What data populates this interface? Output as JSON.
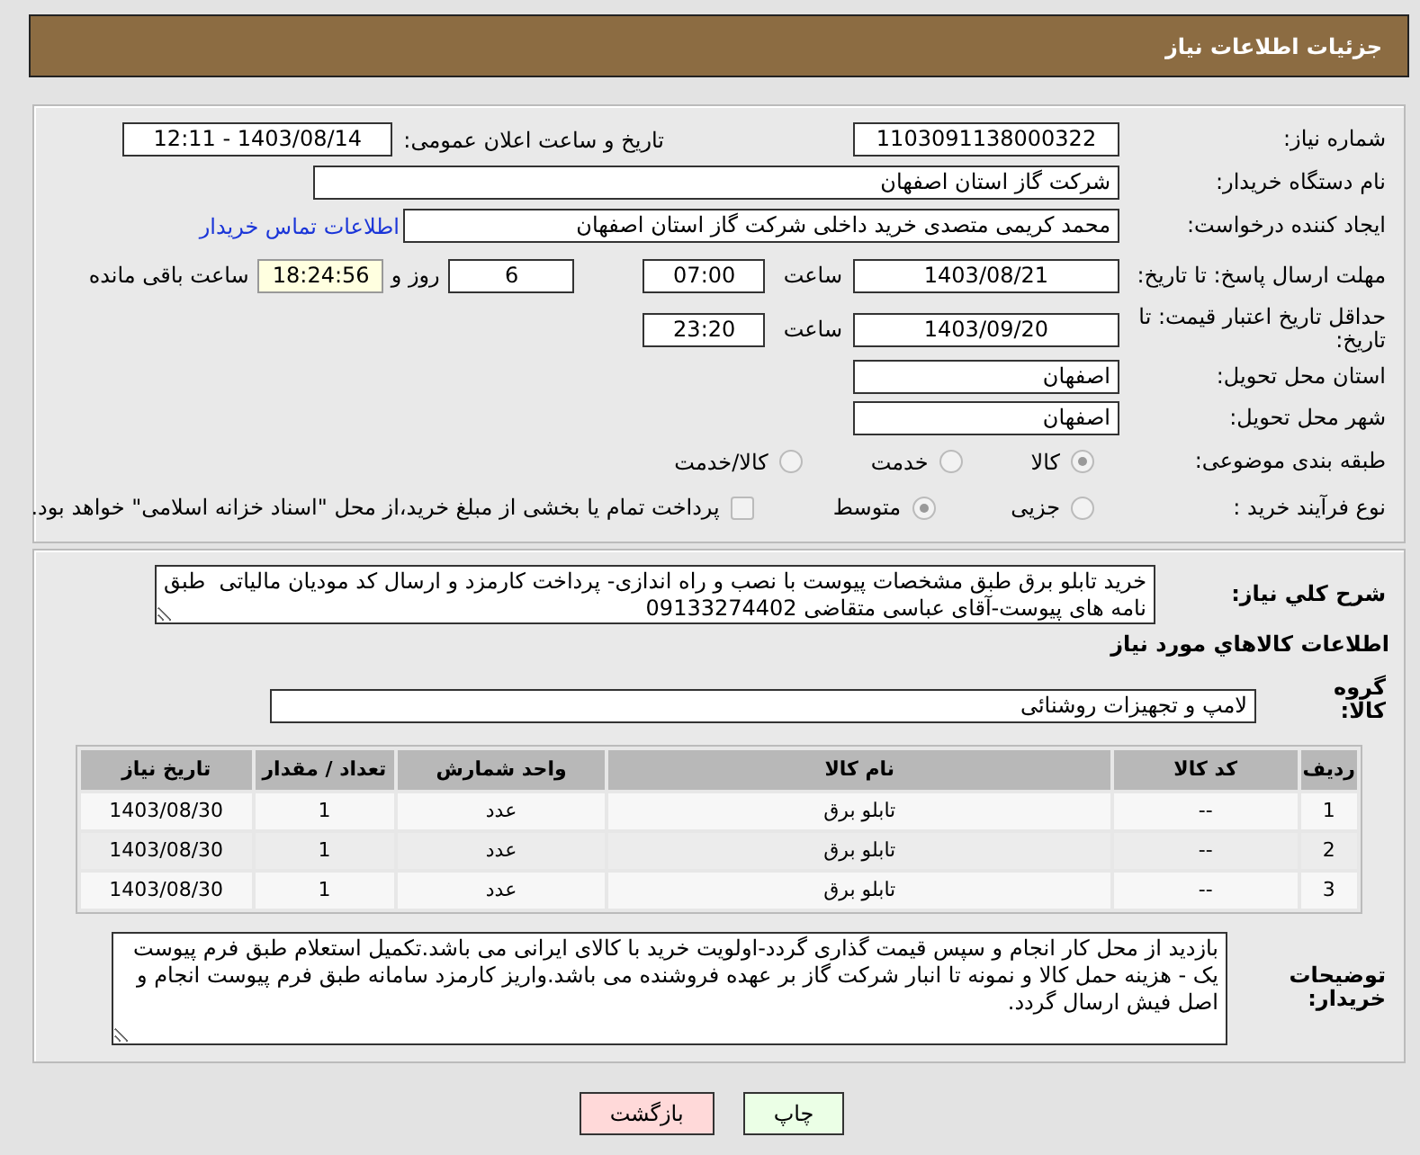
{
  "header": {
    "title": "جزئیات اطلاعات نیاز"
  },
  "need_number": {
    "label": "شماره نیاز:",
    "value": "1103091138000322"
  },
  "announce": {
    "label": "تاریخ و ساعت اعلان عمومی:",
    "value": "1403/08/14 - 12:11"
  },
  "buyer_org": {
    "label": "نام دستگاه خریدار:",
    "value": "شرکت گاز استان اصفهان"
  },
  "requester": {
    "label": "ایجاد کننده درخواست:",
    "value": "محمد کریمی متصدی خرید داخلی شرکت گاز استان اصفهان",
    "link": "اطلاعات تماس خریدار"
  },
  "reply_deadline": {
    "label": "مهلت ارسال پاسخ: تا تاریخ:",
    "date": "1403/08/21",
    "time_label": "ساعت",
    "time": "07:00",
    "days": "6",
    "days_label": "روز و",
    "remaining": "18:24:56",
    "remaining_label": "ساعت باقی مانده"
  },
  "price_validity": {
    "label": "حداقل تاریخ اعتبار قیمت: تا تاریخ:",
    "date": "1403/09/20",
    "time_label": "ساعت",
    "time": "23:20"
  },
  "province": {
    "label": "استان محل تحویل:",
    "value": "اصفهان"
  },
  "city": {
    "label": "شهر محل تحویل:",
    "value": "اصفهان"
  },
  "category": {
    "label": "طبقه بندی موضوعی:",
    "options": [
      {
        "label": "کالا",
        "selected": true
      },
      {
        "label": "خدمت",
        "selected": false
      },
      {
        "label": "کالا/خدمت",
        "selected": false
      }
    ]
  },
  "process": {
    "label": "نوع فرآیند خرید :",
    "options": [
      {
        "label": "جزیی",
        "selected": false
      },
      {
        "label": "متوسط",
        "selected": true
      }
    ],
    "treasury": {
      "label": "پرداخت تمام یا بخشی از مبلغ خرید،از محل \"اسناد خزانه اسلامی\" خواهد بود.",
      "checked": false
    }
  },
  "description": {
    "label": "شرح کلي نياز:",
    "value": "خرید تابلو برق طبق مشخصات پیوست با نصب و راه اندازی- پرداخت کارمزد و ارسال کد مودیان مالیاتی  طبق نامه های پیوست-آقای عباسی متقاضی 09133274402"
  },
  "goods_title": "اطلاعات کالاهاي مورد نياز",
  "goods_group": {
    "label": "گروه کالا:",
    "value": "لامپ و تجهیزات روشنائی"
  },
  "table": {
    "columns": [
      "ردیف",
      "کد کالا",
      "نام کالا",
      "واحد شمارش",
      "تعداد / مقدار",
      "تاریخ نیاز"
    ],
    "rows": [
      [
        "1",
        "--",
        "تابلو برق",
        "عدد",
        "1",
        "1403/08/30"
      ],
      [
        "2",
        "--",
        "تابلو برق",
        "عدد",
        "1",
        "1403/08/30"
      ],
      [
        "3",
        "--",
        "تابلو برق",
        "عدد",
        "1",
        "1403/08/30"
      ]
    ]
  },
  "buyer_notes": {
    "label": "توضیحات خریدار:",
    "value": "بازدید از محل کار انجام و سپس قیمت گذاری گردد-اولویت خرید با کالای ایرانی می باشد.تکمیل استعلام طبق فرم پیوست یک - هزینه حمل کالا و نمونه تا انبار شرکت گاز بر عهده فروشنده می باشد.واریز کارمزد سامانه طبق فرم پیوست انجام و اصل فیش ارسال گردد."
  },
  "buttons": [
    {
      "label": "چاپ",
      "kind": "print"
    },
    {
      "label": "بازگشت",
      "kind": "back"
    }
  ]
}
